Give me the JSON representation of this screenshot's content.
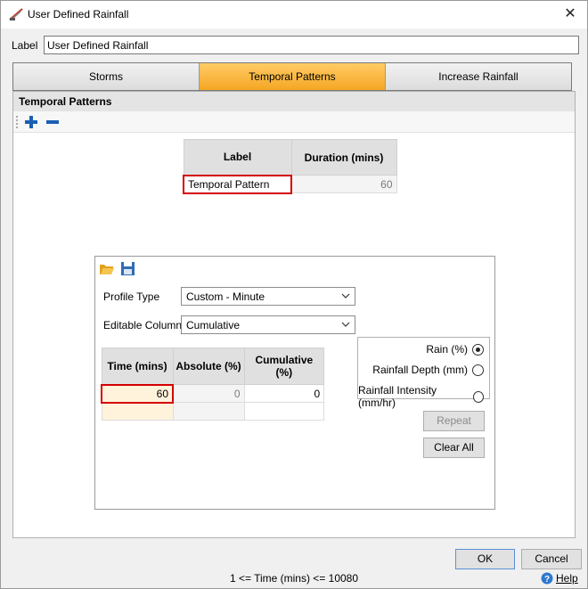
{
  "window": {
    "title": "User Defined Rainfall",
    "close_glyph": "✕"
  },
  "label_field": {
    "label": "Label",
    "value": "User Defined Rainfall"
  },
  "tabs": [
    {
      "label": "Storms",
      "active": false
    },
    {
      "label": "Temporal Patterns",
      "active": true
    },
    {
      "label": "Increase Rainfall",
      "active": false
    }
  ],
  "section": {
    "title": "Temporal Patterns"
  },
  "patterns_table": {
    "headers": [
      "Label",
      "Duration (mins)"
    ],
    "rows": [
      {
        "label": "Temporal Pattern",
        "duration": "60"
      }
    ]
  },
  "editor": {
    "profile_type": {
      "label": "Profile Type",
      "value": "Custom - Minute"
    },
    "editable_column": {
      "label": "Editable Column",
      "value": "Cumulative"
    },
    "table": {
      "headers": [
        "Time (mins)",
        "Absolute (%)",
        "Cumulative (%)"
      ],
      "rows": [
        {
          "time": "60",
          "absolute": "0",
          "cumulative": "0"
        }
      ]
    },
    "radios": [
      {
        "label": "Rain (%)",
        "selected": true
      },
      {
        "label": "Rainfall Depth (mm)",
        "selected": false
      },
      {
        "label": "Rainfall Intensity (mm/hr)",
        "selected": false
      }
    ],
    "repeat_label": "Repeat",
    "clear_all_label": "Clear All"
  },
  "footer": {
    "ok_label": "OK",
    "cancel_label": "Cancel",
    "status_text": "1 <= Time (mins) <= 10080",
    "help_label": "Help"
  },
  "colors": {
    "active_tab": "#f5a623",
    "error_border": "#d40000",
    "add_icon": "#1a5fb4"
  }
}
